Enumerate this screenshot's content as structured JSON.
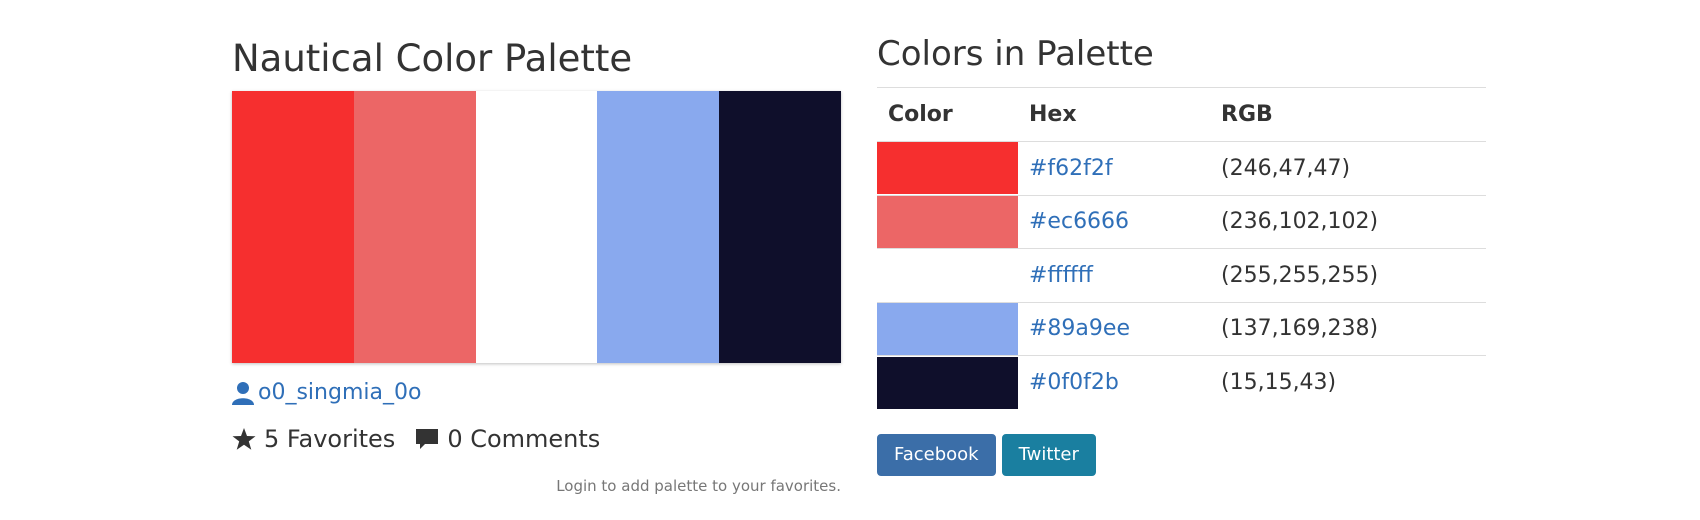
{
  "palette": {
    "title": "Nautical Color Palette",
    "colors": [
      "#f62f2f",
      "#ec6666",
      "#ffffff",
      "#89a9ee",
      "#0f0f2b"
    ],
    "author": "o0_singmia_0o",
    "favorites": "5 Favorites",
    "comments": "0 Comments",
    "login_note": "Login to add palette to your favorites."
  },
  "colors_section": {
    "title": "Colors in Palette",
    "headers": {
      "color": "Color",
      "hex": "Hex",
      "rgb": "RGB"
    },
    "rows": [
      {
        "swatch": "#f62f2f",
        "hex": "#f62f2f",
        "rgb": "(246,47,47)"
      },
      {
        "swatch": "#ec6666",
        "hex": "#ec6666",
        "rgb": "(236,102,102)"
      },
      {
        "swatch": "#ffffff",
        "hex": "#ffffff",
        "rgb": "(255,255,255)"
      },
      {
        "swatch": "#89a9ee",
        "hex": "#89a9ee",
        "rgb": "(137,169,238)"
      },
      {
        "swatch": "#0f0f2b",
        "hex": "#0f0f2b",
        "rgb": "(15,15,43)"
      }
    ]
  },
  "share": {
    "facebook_label": "Facebook",
    "facebook_color": "#3b6ea8",
    "twitter_label": "Twitter",
    "twitter_color": "#1a7fa0"
  },
  "icons": {
    "user": "user-icon",
    "star": "star-icon",
    "comment": "comment-icon"
  },
  "link_color": "#2f6fb8"
}
